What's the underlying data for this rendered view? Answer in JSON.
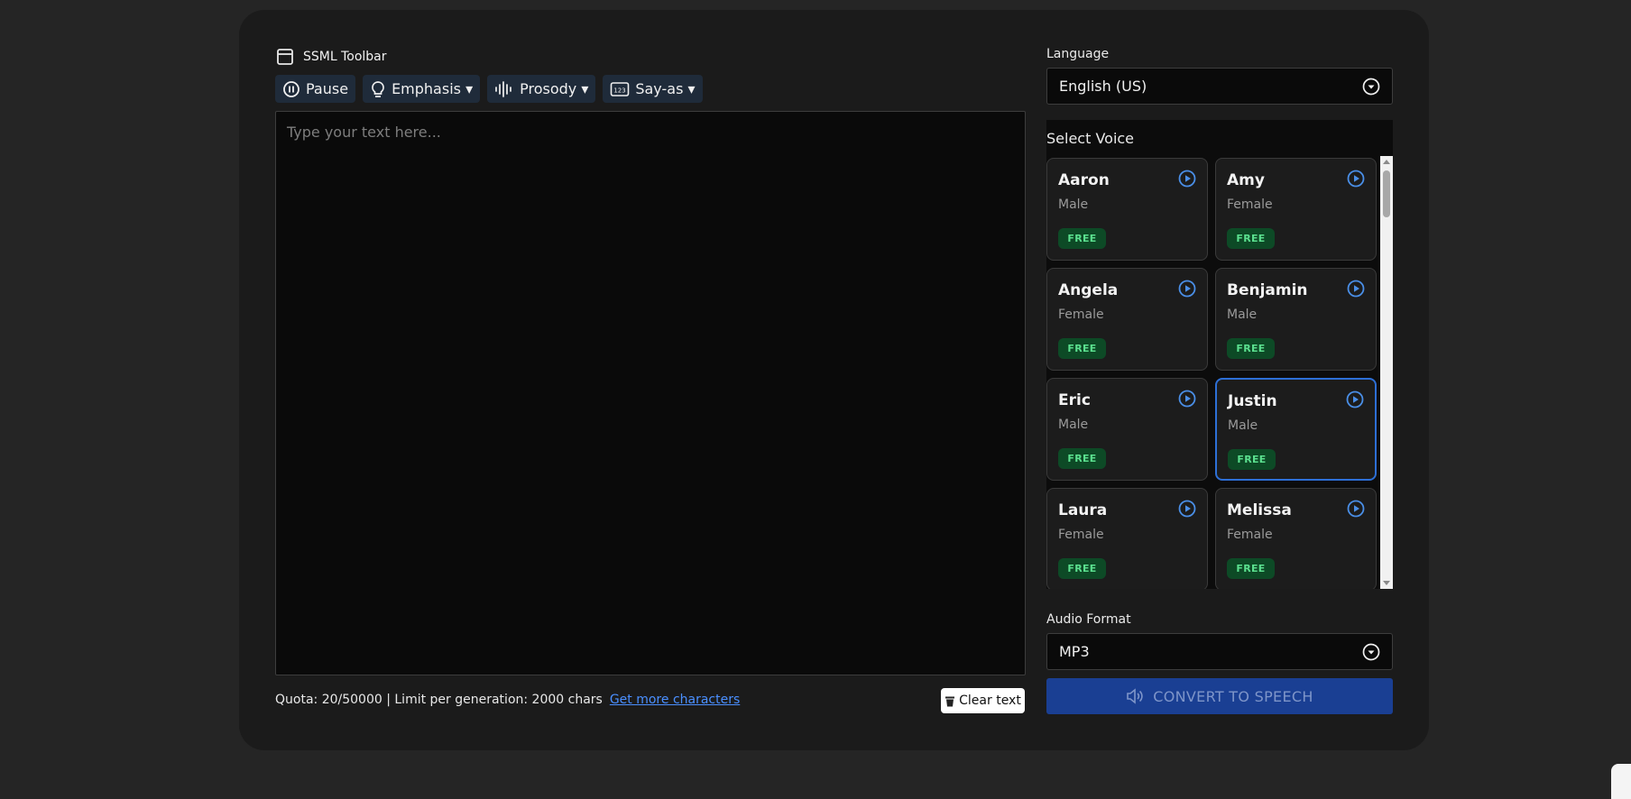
{
  "toolbar": {
    "title": "SSML Toolbar",
    "buttons": {
      "pause": "Pause",
      "emphasis": "Emphasis ▾",
      "prosody": "Prosody ▾",
      "say_as": "Say-as ▾"
    }
  },
  "editor": {
    "placeholder": "Type your text here...",
    "value": ""
  },
  "footer": {
    "quota_text": "Quota: 20/50000 | Limit per generation: 2000 chars",
    "more_link": "Get more characters",
    "clear_label": "Clear text"
  },
  "language": {
    "label": "Language",
    "selected": "English (US)"
  },
  "voices": {
    "label": "Select Voice",
    "items": [
      {
        "name": "Aaron",
        "gender": "Male",
        "badge": "FREE"
      },
      {
        "name": "Amy",
        "gender": "Female",
        "badge": "FREE"
      },
      {
        "name": "Angela",
        "gender": "Female",
        "badge": "FREE"
      },
      {
        "name": "Benjamin",
        "gender": "Male",
        "badge": "FREE"
      },
      {
        "name": "Eric",
        "gender": "Male",
        "badge": "FREE"
      },
      {
        "name": "Justin",
        "gender": "Male",
        "badge": "FREE",
        "selected": true
      },
      {
        "name": "Laura",
        "gender": "Female",
        "badge": "FREE"
      },
      {
        "name": "Melissa",
        "gender": "Female",
        "badge": "FREE"
      }
    ]
  },
  "audio_format": {
    "label": "Audio Format",
    "selected": "MP3"
  },
  "convert": {
    "label": "CONVERT TO SPEECH"
  },
  "colors": {
    "accent": "#2d6fd6",
    "convert_bg": "#1a3f93",
    "badge_bg": "#0d4a26",
    "badge_text": "#5be08f",
    "link": "#4a8fff"
  }
}
